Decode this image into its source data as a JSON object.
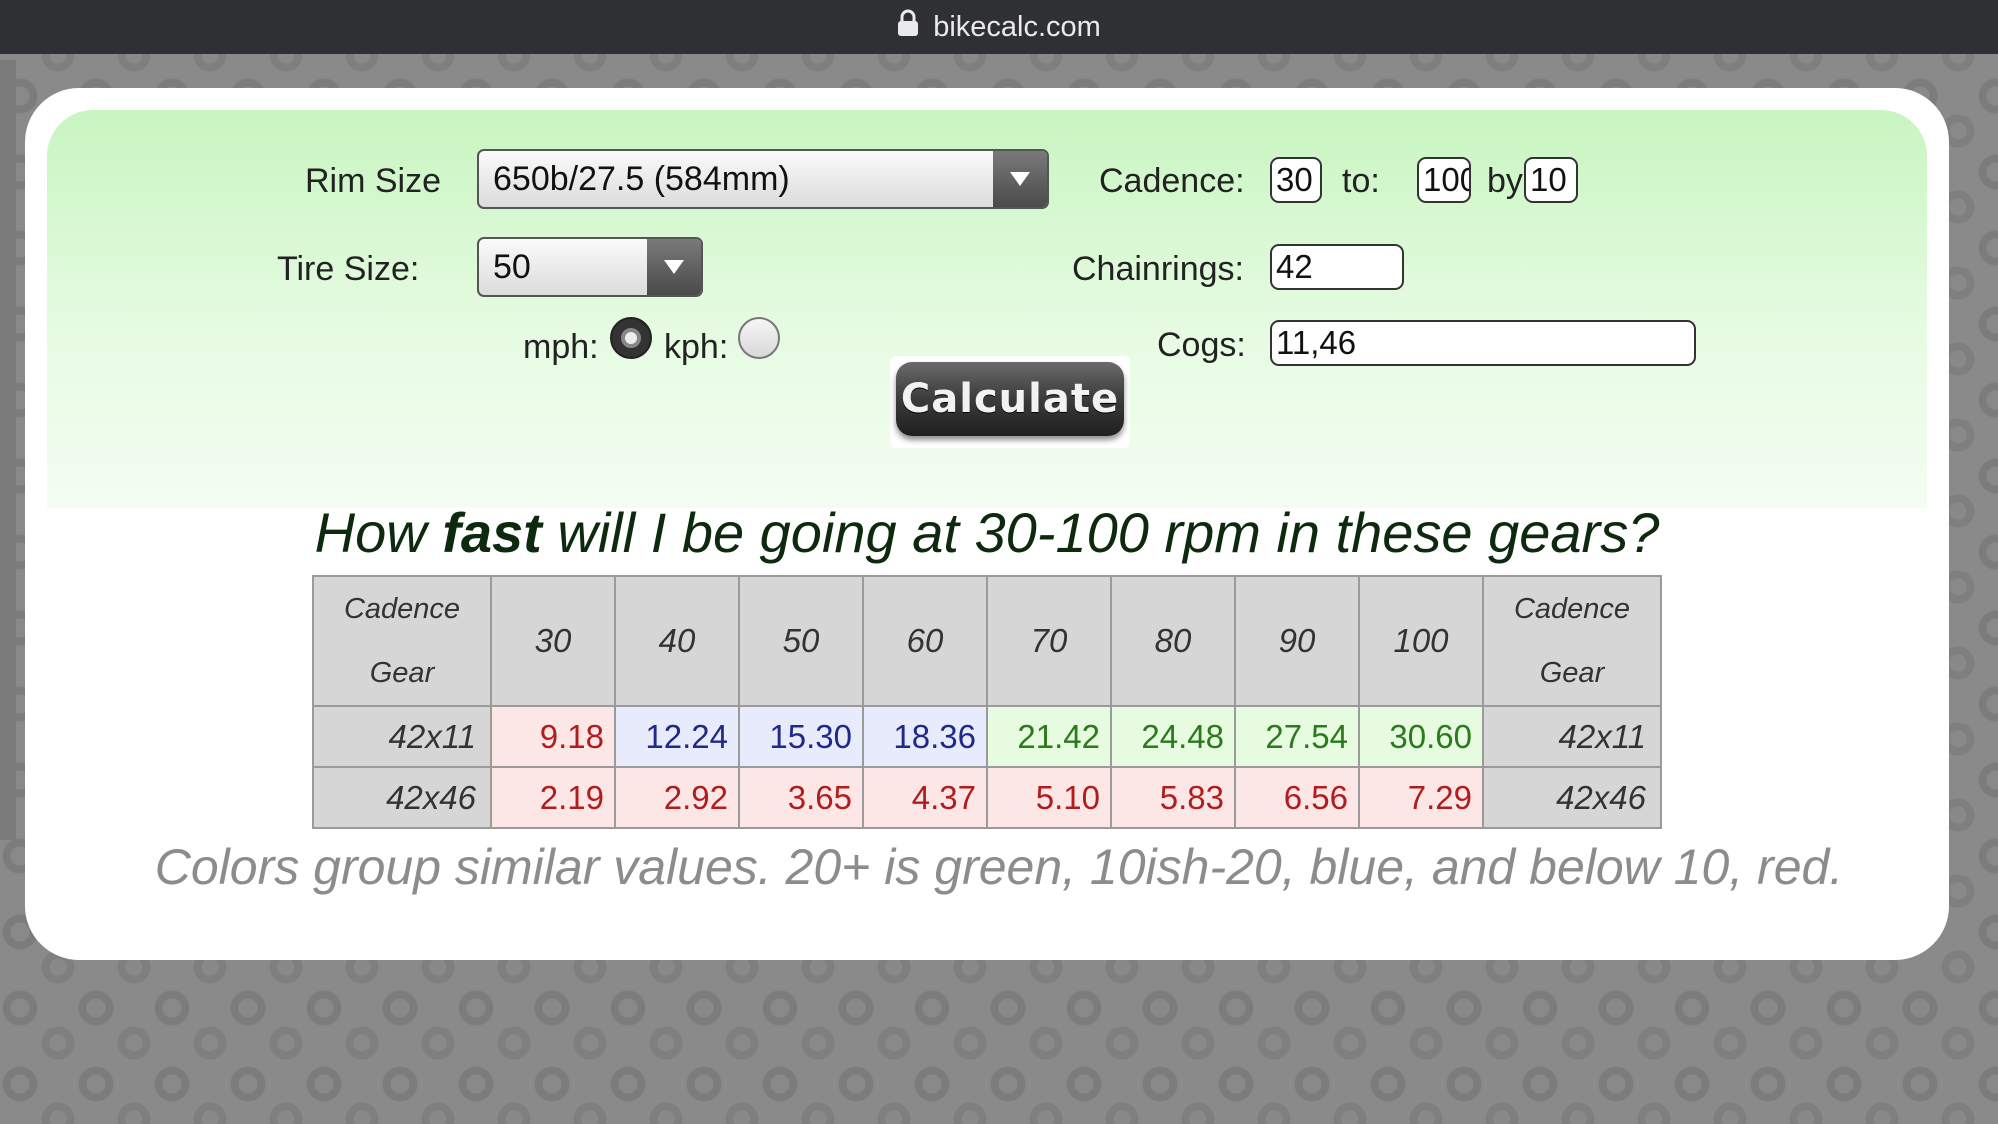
{
  "browser": {
    "url": "bikecalc.com"
  },
  "form": {
    "rim_size_label": "Rim Size",
    "rim_size_value": "650b/27.5 (584mm)",
    "tire_size_label": "Tire Size:",
    "tire_size_value": "50",
    "mph_label": "mph:",
    "kph_label": "kph:",
    "selected_unit": "mph",
    "cadence_label": "Cadence:",
    "cadence_from": "30",
    "to_label": "to:",
    "cadence_to": "100",
    "by_label": "by:",
    "cadence_by": "10",
    "chainrings_label": "Chainrings:",
    "chainrings_value": "42",
    "cogs_label": "Cogs:",
    "cogs_value": "11,46",
    "calculate_label": "Calculate"
  },
  "question": {
    "prefix": "How ",
    "bold": "fast",
    "suffix": " will I be going at 30-100 rpm in these gears?"
  },
  "table": {
    "corner_top": "Cadence",
    "corner_bottom": "Gear",
    "cadences": [
      "30",
      "40",
      "50",
      "60",
      "70",
      "80",
      "90",
      "100"
    ],
    "rows": [
      {
        "gear": "42x11",
        "values": [
          "9.18",
          "12.24",
          "15.30",
          "18.36",
          "21.42",
          "24.48",
          "27.54",
          "30.60"
        ],
        "colors": [
          "red",
          "blue",
          "blue",
          "blue",
          "green",
          "green",
          "green",
          "green"
        ]
      },
      {
        "gear": "42x46",
        "values": [
          "2.19",
          "2.92",
          "3.65",
          "4.37",
          "5.10",
          "5.83",
          "6.56",
          "7.29"
        ],
        "colors": [
          "red",
          "red",
          "red",
          "red",
          "red",
          "red",
          "red",
          "red"
        ]
      }
    ]
  },
  "legend": "Colors group similar values. 20+ is green, 10ish-20, blue, and below 10, red.",
  "colors": {
    "green_text": "#2b7a1c",
    "blue_text": "#1e2a8a",
    "red_text": "#b11d1d"
  }
}
